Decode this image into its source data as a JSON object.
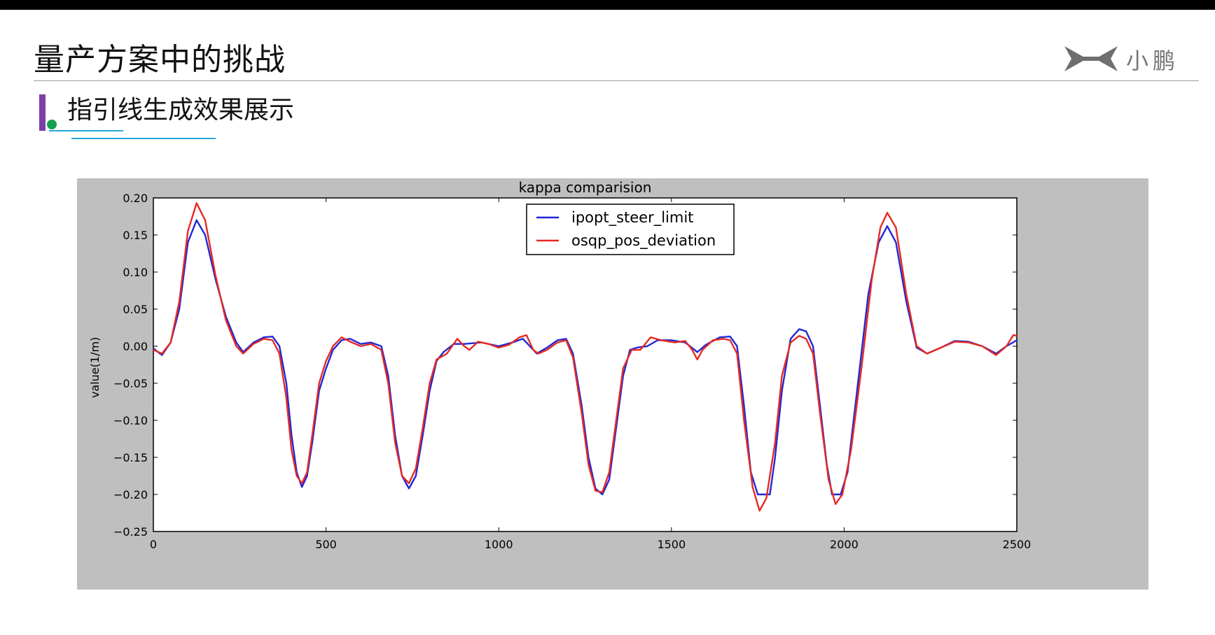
{
  "slide": {
    "title": "量产方案中的挑战",
    "subtitle": "指引线生成效果展示",
    "logo_text": "小鹏"
  },
  "colors": {
    "top_bar": "#000000",
    "accent_purple": "#7b3fa7",
    "accent_green": "#16a04e",
    "accent_blue_line": "#26a8d8",
    "series_blue": "#2127d6",
    "series_red": "#e62a22",
    "plot_frame": "#bfbfbf"
  },
  "chart_data": {
    "type": "line",
    "title": "kappa comparision",
    "xlabel": "",
    "ylabel": "value(1/m)",
    "xlim": [
      0,
      2500
    ],
    "ylim": [
      -0.25,
      0.2
    ],
    "xticks": [
      0,
      500,
      1000,
      1500,
      2000,
      2500
    ],
    "yticks": [
      -0.25,
      -0.2,
      -0.15,
      -0.1,
      -0.05,
      0.0,
      0.05,
      0.1,
      0.15,
      0.2
    ],
    "ytick_labels": [
      "−0.25",
      "−0.20",
      "−0.15",
      "−0.10",
      "−0.05",
      "0.00",
      "0.05",
      "0.10",
      "0.15",
      "0.20"
    ],
    "grid": false,
    "legend_position": "top-center",
    "series": [
      {
        "name": "ipopt_steer_limit",
        "color": "#2127d6",
        "points": [
          [
            0,
            -0.003
          ],
          [
            25,
            -0.012
          ],
          [
            50,
            0.005
          ],
          [
            75,
            0.05
          ],
          [
            100,
            0.14
          ],
          [
            125,
            0.17
          ],
          [
            150,
            0.15
          ],
          [
            180,
            0.09
          ],
          [
            210,
            0.04
          ],
          [
            240,
            0.005
          ],
          [
            260,
            -0.008
          ],
          [
            290,
            0.005
          ],
          [
            320,
            0.012
          ],
          [
            345,
            0.013
          ],
          [
            365,
            0.0
          ],
          [
            385,
            -0.05
          ],
          [
            400,
            -0.12
          ],
          [
            415,
            -0.17
          ],
          [
            430,
            -0.19
          ],
          [
            445,
            -0.175
          ],
          [
            460,
            -0.13
          ],
          [
            480,
            -0.06
          ],
          [
            500,
            -0.03
          ],
          [
            520,
            -0.005
          ],
          [
            545,
            0.008
          ],
          [
            570,
            0.01
          ],
          [
            600,
            0.003
          ],
          [
            630,
            0.005
          ],
          [
            660,
            0.0
          ],
          [
            680,
            -0.04
          ],
          [
            700,
            -0.12
          ],
          [
            720,
            -0.175
          ],
          [
            740,
            -0.192
          ],
          [
            760,
            -0.175
          ],
          [
            780,
            -0.12
          ],
          [
            800,
            -0.06
          ],
          [
            820,
            -0.02
          ],
          [
            840,
            -0.008
          ],
          [
            870,
            0.003
          ],
          [
            900,
            0.003
          ],
          [
            950,
            0.005
          ],
          [
            1000,
            0.0
          ],
          [
            1040,
            0.005
          ],
          [
            1070,
            0.01
          ],
          [
            1110,
            -0.01
          ],
          [
            1140,
            -0.002
          ],
          [
            1170,
            0.008
          ],
          [
            1195,
            0.01
          ],
          [
            1215,
            -0.01
          ],
          [
            1240,
            -0.08
          ],
          [
            1260,
            -0.15
          ],
          [
            1280,
            -0.192
          ],
          [
            1300,
            -0.2
          ],
          [
            1320,
            -0.18
          ],
          [
            1340,
            -0.11
          ],
          [
            1360,
            -0.04
          ],
          [
            1380,
            -0.005
          ],
          [
            1400,
            -0.002
          ],
          [
            1430,
            0.0
          ],
          [
            1460,
            0.008
          ],
          [
            1500,
            0.008
          ],
          [
            1540,
            0.005
          ],
          [
            1575,
            -0.008
          ],
          [
            1600,
            0.002
          ],
          [
            1640,
            0.012
          ],
          [
            1670,
            0.013
          ],
          [
            1690,
            0.0
          ],
          [
            1710,
            -0.08
          ],
          [
            1730,
            -0.17
          ],
          [
            1750,
            -0.2
          ],
          [
            1785,
            -0.2
          ],
          [
            1800,
            -0.15
          ],
          [
            1820,
            -0.06
          ],
          [
            1845,
            0.01
          ],
          [
            1870,
            0.023
          ],
          [
            1890,
            0.02
          ],
          [
            1910,
            0.0
          ],
          [
            1930,
            -0.08
          ],
          [
            1950,
            -0.16
          ],
          [
            1965,
            -0.2
          ],
          [
            1990,
            -0.2
          ],
          [
            2010,
            -0.17
          ],
          [
            2040,
            -0.05
          ],
          [
            2070,
            0.07
          ],
          [
            2100,
            0.14
          ],
          [
            2125,
            0.162
          ],
          [
            2150,
            0.14
          ],
          [
            2180,
            0.06
          ],
          [
            2210,
            -0.002
          ],
          [
            2240,
            -0.01
          ],
          [
            2280,
            -0.002
          ],
          [
            2320,
            0.007
          ],
          [
            2360,
            0.006
          ],
          [
            2400,
            0.0
          ],
          [
            2440,
            -0.01
          ],
          [
            2470,
            0.0
          ],
          [
            2500,
            0.008
          ]
        ]
      },
      {
        "name": "osqp_pos_deviation",
        "color": "#e62a22",
        "points": [
          [
            0,
            -0.005
          ],
          [
            25,
            -0.01
          ],
          [
            50,
            0.005
          ],
          [
            75,
            0.06
          ],
          [
            100,
            0.155
          ],
          [
            125,
            0.193
          ],
          [
            150,
            0.17
          ],
          [
            180,
            0.095
          ],
          [
            210,
            0.035
          ],
          [
            240,
            0.0
          ],
          [
            260,
            -0.01
          ],
          [
            290,
            0.003
          ],
          [
            320,
            0.01
          ],
          [
            345,
            0.008
          ],
          [
            365,
            -0.01
          ],
          [
            385,
            -0.07
          ],
          [
            400,
            -0.14
          ],
          [
            415,
            -0.175
          ],
          [
            430,
            -0.185
          ],
          [
            445,
            -0.17
          ],
          [
            460,
            -0.12
          ],
          [
            480,
            -0.05
          ],
          [
            500,
            -0.02
          ],
          [
            520,
            0.0
          ],
          [
            545,
            0.012
          ],
          [
            570,
            0.006
          ],
          [
            600,
            0.0
          ],
          [
            630,
            0.003
          ],
          [
            660,
            -0.005
          ],
          [
            680,
            -0.05
          ],
          [
            700,
            -0.13
          ],
          [
            720,
            -0.175
          ],
          [
            740,
            -0.185
          ],
          [
            760,
            -0.165
          ],
          [
            780,
            -0.11
          ],
          [
            800,
            -0.05
          ],
          [
            820,
            -0.018
          ],
          [
            850,
            -0.01
          ],
          [
            880,
            0.01
          ],
          [
            900,
            0.0
          ],
          [
            915,
            -0.005
          ],
          [
            940,
            0.006
          ],
          [
            970,
            0.003
          ],
          [
            1000,
            -0.002
          ],
          [
            1030,
            0.002
          ],
          [
            1060,
            0.012
          ],
          [
            1080,
            0.015
          ],
          [
            1100,
            -0.005
          ],
          [
            1115,
            -0.01
          ],
          [
            1140,
            -0.005
          ],
          [
            1170,
            0.005
          ],
          [
            1195,
            0.008
          ],
          [
            1215,
            -0.015
          ],
          [
            1240,
            -0.09
          ],
          [
            1260,
            -0.16
          ],
          [
            1280,
            -0.195
          ],
          [
            1300,
            -0.197
          ],
          [
            1320,
            -0.17
          ],
          [
            1340,
            -0.1
          ],
          [
            1360,
            -0.03
          ],
          [
            1385,
            -0.005
          ],
          [
            1410,
            -0.005
          ],
          [
            1440,
            0.012
          ],
          [
            1470,
            0.008
          ],
          [
            1510,
            0.005
          ],
          [
            1540,
            0.007
          ],
          [
            1560,
            -0.005
          ],
          [
            1575,
            -0.018
          ],
          [
            1590,
            -0.005
          ],
          [
            1620,
            0.008
          ],
          [
            1650,
            0.01
          ],
          [
            1670,
            0.008
          ],
          [
            1690,
            -0.01
          ],
          [
            1710,
            -0.1
          ],
          [
            1735,
            -0.19
          ],
          [
            1755,
            -0.222
          ],
          [
            1775,
            -0.205
          ],
          [
            1800,
            -0.13
          ],
          [
            1820,
            -0.04
          ],
          [
            1845,
            0.005
          ],
          [
            1870,
            0.014
          ],
          [
            1890,
            0.01
          ],
          [
            1910,
            -0.01
          ],
          [
            1930,
            -0.09
          ],
          [
            1955,
            -0.18
          ],
          [
            1975,
            -0.213
          ],
          [
            1995,
            -0.2
          ],
          [
            2020,
            -0.14
          ],
          [
            2050,
            -0.03
          ],
          [
            2080,
            0.09
          ],
          [
            2105,
            0.16
          ],
          [
            2125,
            0.18
          ],
          [
            2150,
            0.16
          ],
          [
            2180,
            0.07
          ],
          [
            2210,
            0.0
          ],
          [
            2240,
            -0.01
          ],
          [
            2280,
            -0.002
          ],
          [
            2320,
            0.006
          ],
          [
            2360,
            0.005
          ],
          [
            2400,
            0.0
          ],
          [
            2440,
            -0.012
          ],
          [
            2470,
            0.0
          ],
          [
            2490,
            0.015
          ],
          [
            2500,
            0.014
          ]
        ]
      }
    ]
  }
}
